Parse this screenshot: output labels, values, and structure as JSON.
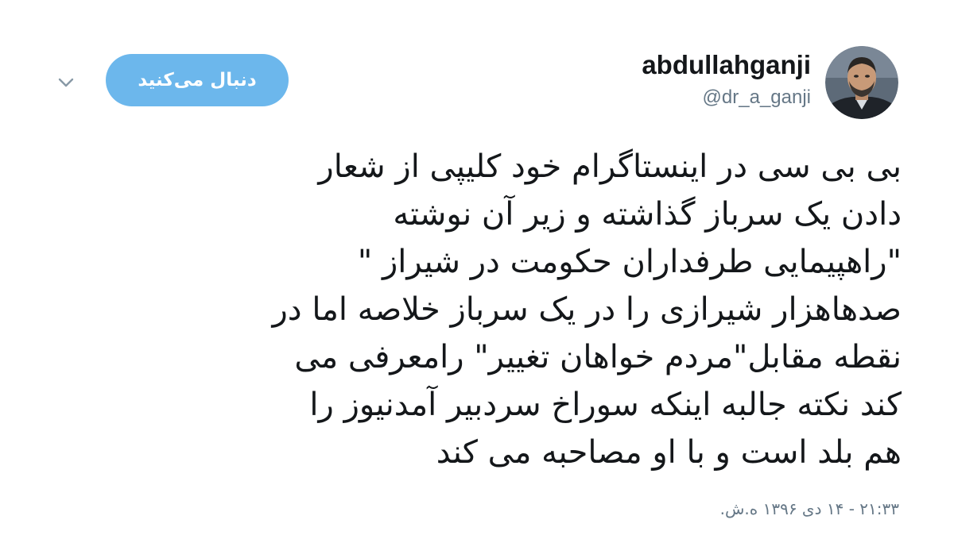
{
  "user": {
    "display_name": "abdullahganji",
    "handle": "@dr_a_ganji"
  },
  "follow_button": {
    "label": "دنبال می‌کنید",
    "color": "#6cb7ec"
  },
  "menu": {
    "icon": "chevron-down-icon"
  },
  "tweet": {
    "lines": [
      "بی بی سی در اینستاگرام خود کلیپی از شعار",
      "دادن یک سرباز گذاشته و زیر آن نوشته",
      "\"راهپیمایی طرفداران حکومت در شیراز \"",
      "صدهاهزار شیرازی را در یک سرباز خلاصه  اما در",
      "نقطه مقابل\"مردم خواهان تغییر\" رامعرفی می",
      "کند نکته جالبه اینکه سوراخ سردبیر آمدنیوز را",
      "هم بلد است و با او مصاحبه می کند"
    ],
    "timestamp": "۲۱:۳۳ - ۱۴ دی ۱۳۹۶ ه.ش."
  }
}
